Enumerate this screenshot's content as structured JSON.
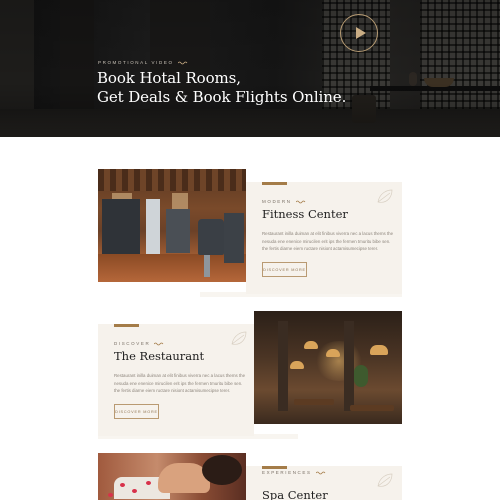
{
  "hero": {
    "eyebrow": "Promotional Video",
    "title_line1": "Book Hotal Rooms,",
    "title_line2": "Get Deals & Book Flights Online."
  },
  "sections": [
    {
      "eyebrow": "Modern",
      "title": "Fitness Center",
      "description": "Restaurant inilla duiman at elit finibus viverra nec a lacus thems the nesuda ene enenice mirucilen erit ips the fermen tmuritu bibe sen. the fertis diarne eiem ructare nisiont actamisumecipse terer.",
      "button": "Discover More"
    },
    {
      "eyebrow": "Discover",
      "title": "The Restaurant",
      "description": "Restaurant inilla duiman at elit finibus viverra nec a lacus thems the nesuda ene enenice mirucilen erit ips the fermen tmuritu bibe sen. the fertis diarne eiem ructare nisiont actamisumecipse terer.",
      "button": "Discover More"
    },
    {
      "eyebrow": "Experiences",
      "title": "Spa Center"
    }
  ],
  "colors": {
    "accent": "#a47c48",
    "card_bg": "#f6f2ec",
    "hero_text": "#ffffff"
  },
  "icons": {
    "play": "play-icon",
    "squiggle": "squiggle-icon",
    "decor": "leaf-decor-icon"
  }
}
